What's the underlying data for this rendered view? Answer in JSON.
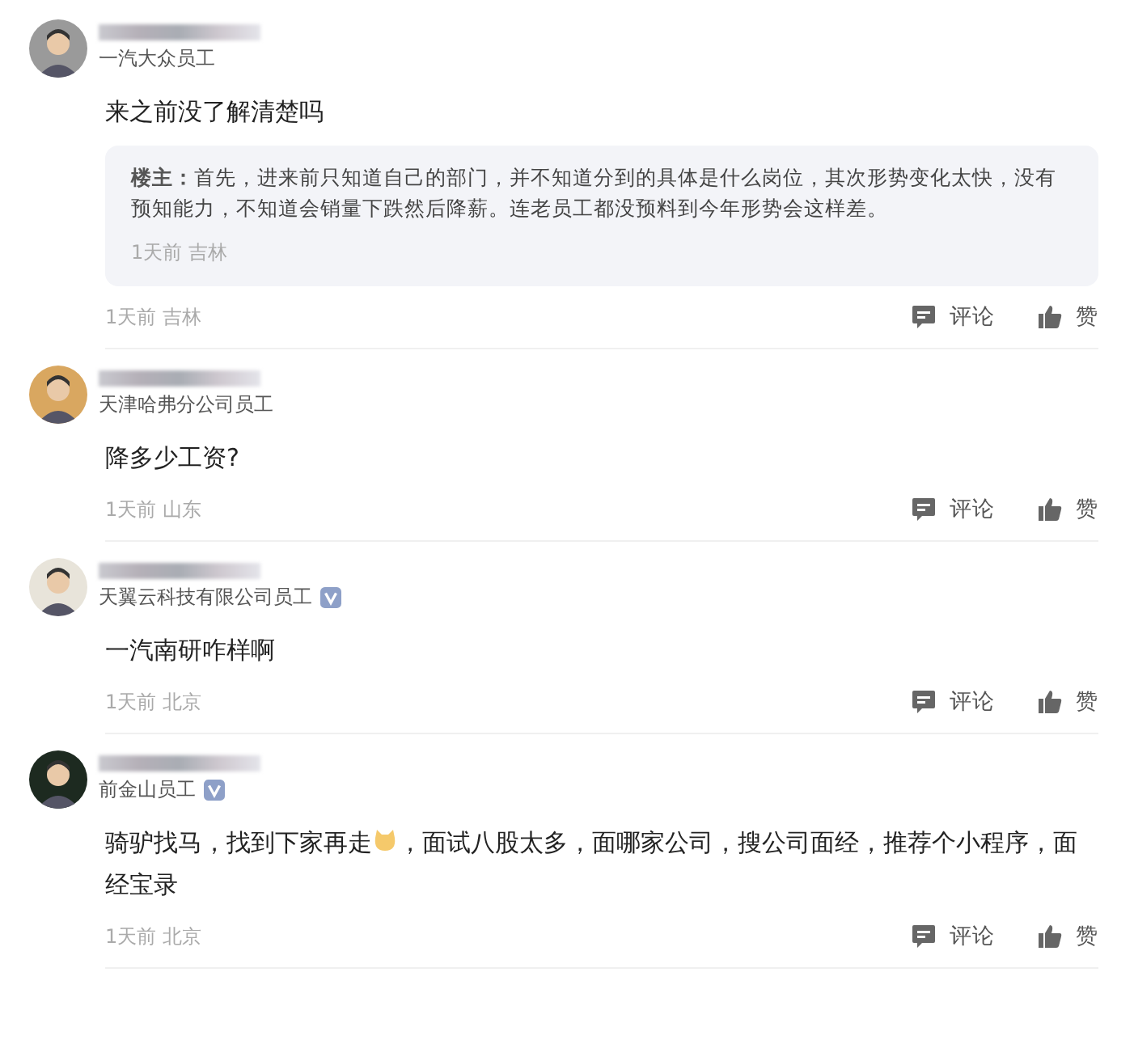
{
  "comments": [
    {
      "company": "一汽大众员工",
      "verified": false,
      "content": [
        "来之前没了解清楚吗"
      ],
      "reply": {
        "author": "楼主：",
        "text": "首先，进来前只知道自己的部门，并不知道分到的具体是什么岗位，其次形势变化太快，没有预知能力，不知道会销量下跌然后降薪。连老员工都没预料到今年形势会这样差。",
        "meta": "1天前 吉林"
      },
      "meta": "1天前 吉林",
      "comment_label": "评论",
      "like_label": "赞"
    },
    {
      "company": "天津哈弗分公司员工",
      "verified": false,
      "content": [
        "降多少工资?"
      ],
      "meta": "1天前 山东",
      "comment_label": "评论",
      "like_label": "赞"
    },
    {
      "company": "天翼云科技有限公司员工",
      "verified": true,
      "content": [
        "一汽南研咋样啊"
      ],
      "meta": "1天前 北京",
      "comment_label": "评论",
      "like_label": "赞"
    },
    {
      "company": "前金山员工",
      "verified": true,
      "content": [
        "骑驴找马，找到下家再走",
        "，面试八股太多，面哪家公司，搜公司面经，推荐个小程序，面经宝录"
      ],
      "meta": "1天前 北京",
      "comment_label": "评论",
      "like_label": "赞"
    }
  ]
}
